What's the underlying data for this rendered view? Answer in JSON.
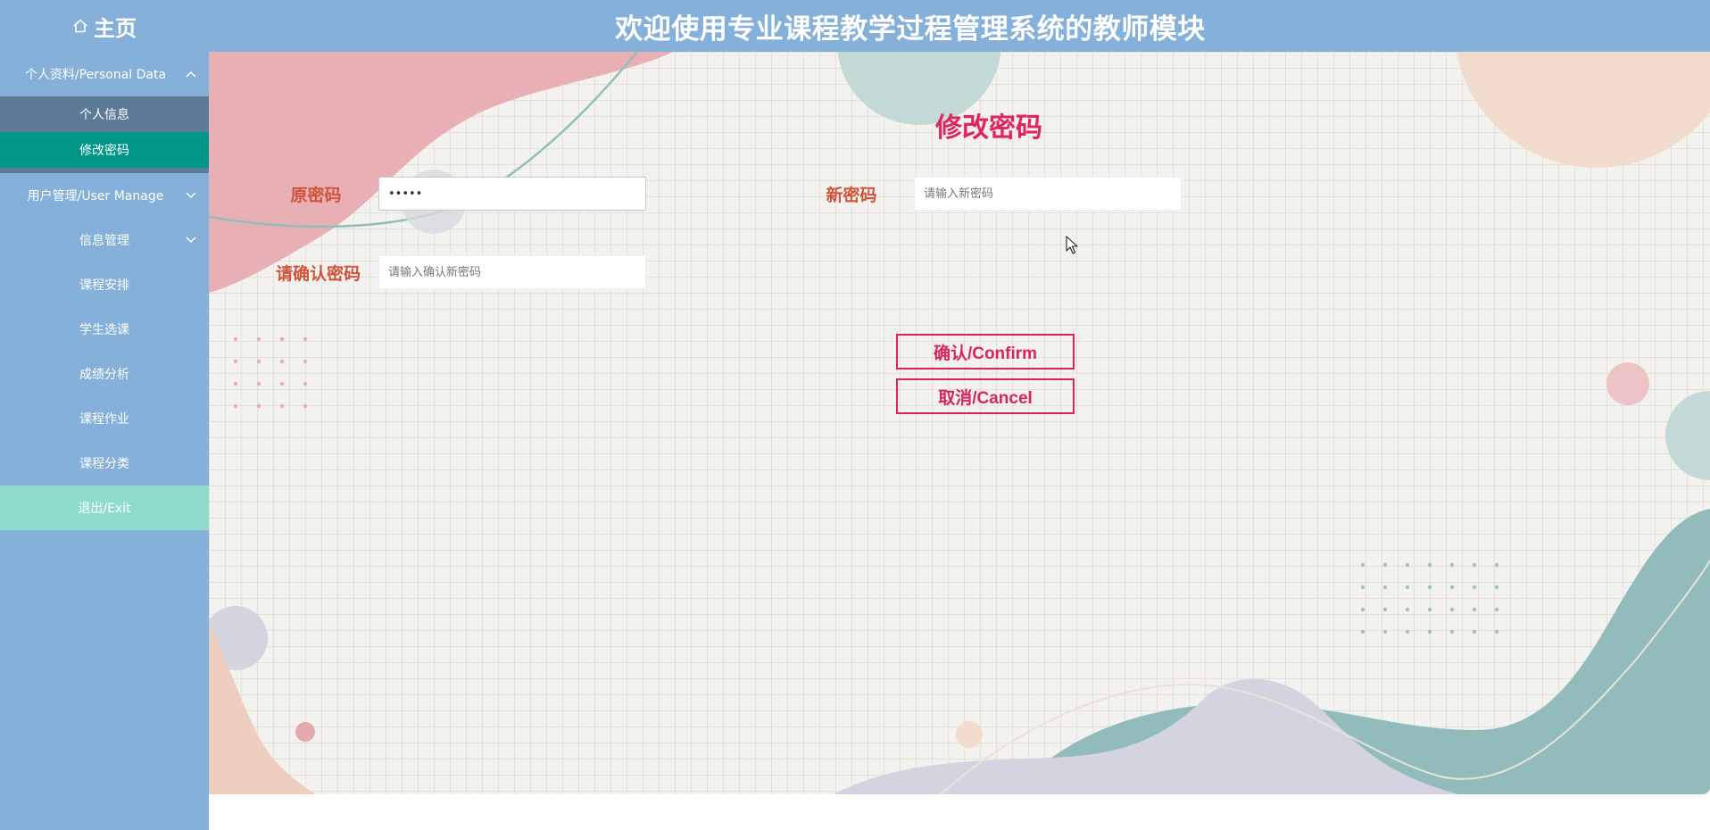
{
  "header": {
    "home_label": "主页",
    "title": "欢迎使用专业课程教学过程管理系统的教师模块"
  },
  "sidebar": {
    "personal": {
      "label": "个人资料/Personal Data",
      "items": [
        {
          "label": "个人信息",
          "active": false
        },
        {
          "label": "修改密码",
          "active": true
        }
      ]
    },
    "user_manage": {
      "label": "用户管理/User Manage",
      "items": [
        {
          "label": "信息管理",
          "has_submenu": true
        },
        {
          "label": "课程安排"
        },
        {
          "label": "学生选课"
        },
        {
          "label": "成绩分析"
        },
        {
          "label": "课程作业"
        },
        {
          "label": "课程分类"
        }
      ]
    },
    "exit_label": "退出/Exit"
  },
  "form": {
    "title": "修改密码",
    "old_password": {
      "label": "原密码",
      "value": "•••••",
      "placeholder": ""
    },
    "new_password": {
      "label": "新密码",
      "value": "",
      "placeholder": "请输入新密码"
    },
    "confirm_password": {
      "label": "请确认密码",
      "value": "",
      "placeholder": "请输入确认新密码"
    },
    "confirm_button": "确认/Confirm",
    "cancel_button": "取消/Cancel"
  },
  "colors": {
    "header_bg": "#85b0d9",
    "sidebar_dark": "#5b7b96",
    "active_item": "#009688",
    "exit_bg": "#8fdccf",
    "accent": "#e0245e",
    "label": "#d0533a"
  },
  "icons": {
    "home": "home-icon",
    "chevron_up": "chevron-up-icon",
    "chevron_down": "chevron-down-icon",
    "cursor": "mouse-cursor-icon"
  }
}
